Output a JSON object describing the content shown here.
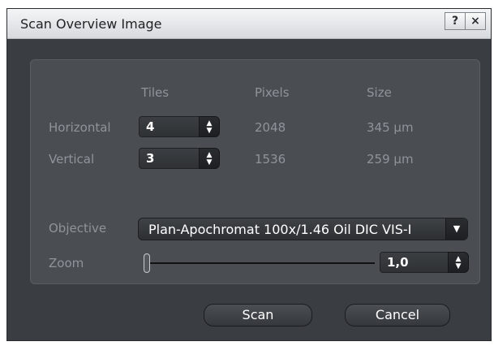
{
  "window": {
    "title": "Scan Overview Image",
    "help_label": "?",
    "close_label": "×"
  },
  "grid": {
    "headers": {
      "tiles": "Tiles",
      "pixels": "Pixels",
      "size": "Size"
    },
    "rows": [
      {
        "label": "Horizontal",
        "tiles": "4",
        "pixels": "2048",
        "size": "345 µm"
      },
      {
        "label": "Vertical",
        "tiles": "3",
        "pixels": "1536",
        "size": "259 µm"
      }
    ]
  },
  "objective": {
    "label": "Objective",
    "value": "Plan-Apochromat 100x/1.46 Oil DIC VIS-I"
  },
  "zoom": {
    "label": "Zoom",
    "value": "1,0",
    "slider_fraction": 0.0
  },
  "buttons": {
    "scan": "Scan",
    "cancel": "Cancel"
  },
  "colors": {
    "background": "#3a3d41",
    "panel": "#4a4e53",
    "label_text": "#8e949a",
    "value_text": "#ffffff"
  }
}
